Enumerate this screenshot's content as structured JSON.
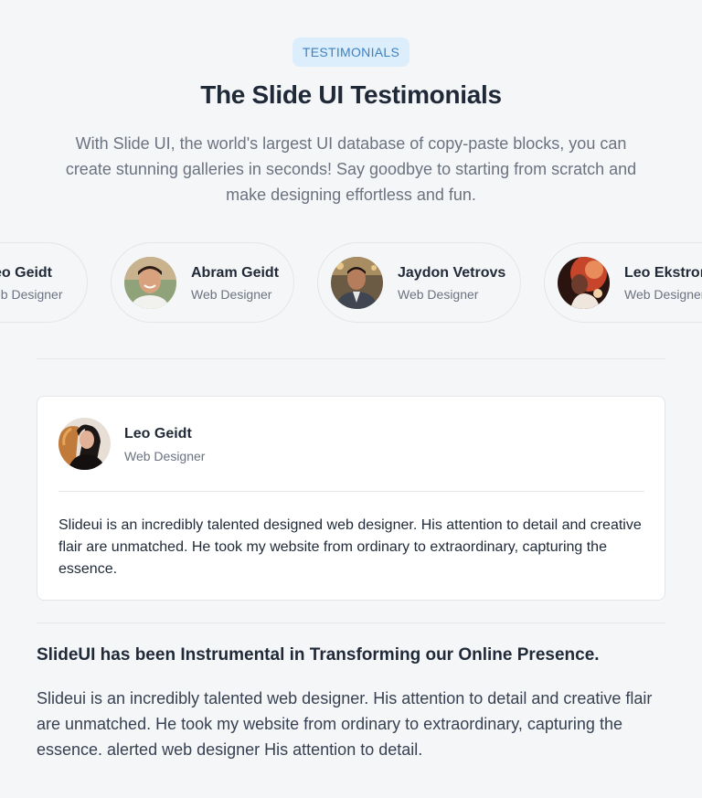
{
  "section": {
    "badge": "TESTIMONIALS",
    "title": "The Slide UI Testimonials",
    "subtitle": "With Slide UI, the world's largest UI database of copy-paste blocks, you can create stunning galleries in seconds! Say goodbye to starting from scratch and make designing effortless and fun."
  },
  "carousel": [
    {
      "name": "eo Geidt",
      "role": "eb Designer"
    },
    {
      "name": "Abram Geidt",
      "role": "Web Designer"
    },
    {
      "name": "Jaydon Vetrovs",
      "role": "Web Designer"
    },
    {
      "name": "Leo Ekstrom",
      "role": "Web Designer"
    }
  ],
  "card": {
    "name": "Leo Geidt",
    "role": "Web Designer",
    "quote": "Slideui is an incredibly talented designed web designer. His attention to detail and creative flair are unmatched. He took my website from ordinary to extraordinary, capturing the essence."
  },
  "feature": {
    "headline": "SlideUI has been Instrumental in Transforming our Online Presence.",
    "body": "Slideui is an incredibly talented web designer. His attention to detail and creative flair are unmatched. He took my website from ordinary to extraordinary, capturing the essence. alerted web designer His attention to detail."
  },
  "colors": {
    "background": "#f5f6f8",
    "badge_bg": "#dcedfb",
    "badge_text": "#3b82c4",
    "card_bg": "#ffffff",
    "muted_text": "#6b7280"
  }
}
